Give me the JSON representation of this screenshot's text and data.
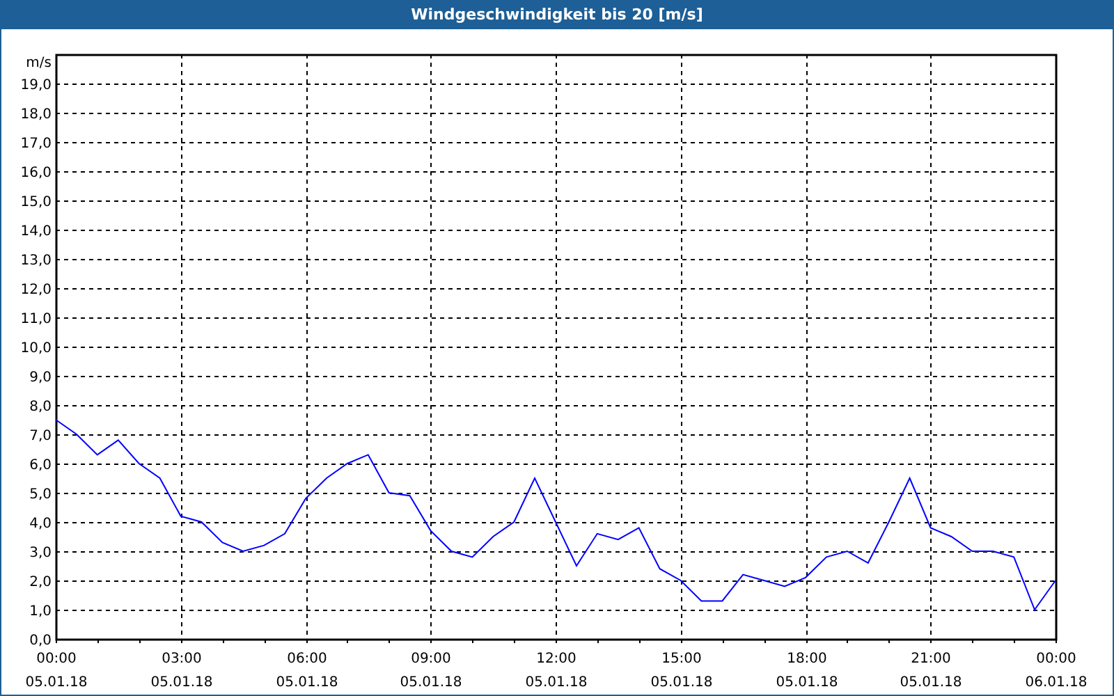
{
  "window": {
    "title": "Windgeschwindigkeit bis 20 [m/s]"
  },
  "chart": {
    "chart_data": {
      "type": "line",
      "ylabel": "m/s",
      "categories": [
        "00:00 05.01.18",
        null,
        null,
        null,
        null,
        null,
        "03:00 05.01.18",
        null,
        null,
        null,
        null,
        null,
        "06:00 05.01.18",
        null,
        null,
        null,
        null,
        null,
        "09:00 05.01.18",
        null,
        null,
        null,
        null,
        null,
        "12:00 05.01.18",
        null,
        null,
        null,
        null,
        null,
        "15:00 05.01.18",
        null,
        null,
        null,
        null,
        null,
        "18:00 05.01.18",
        null,
        null,
        null,
        null,
        null,
        "21:00 05.01.18",
        null,
        null,
        null,
        null,
        null,
        "00:00 06.01.18"
      ],
      "series": [
        {
          "color": "#0000ff",
          "values": [
            7.5,
            7.0,
            6.3,
            6.8,
            6.0,
            5.5,
            4.2,
            4.0,
            3.3,
            3.0,
            3.2,
            3.6,
            4.8,
            5.5,
            6.0,
            6.3,
            5.0,
            4.9,
            3.7,
            3.0,
            2.8,
            3.5,
            4.0,
            5.5,
            4.0,
            2.5,
            3.6,
            3.4,
            3.8,
            2.4,
            2.0,
            1.3,
            1.3,
            2.2,
            2.0,
            1.8,
            2.1,
            2.8,
            3.0,
            2.6,
            4.0,
            5.5,
            3.8,
            3.5,
            3.0,
            3.0,
            2.8,
            1.0,
            2.0
          ]
        }
      ],
      "ylim": [
        0,
        20
      ],
      "grid": true,
      "yticks": [
        {
          "value": 0,
          "label": "0,0"
        },
        {
          "value": 1,
          "label": "1,0"
        },
        {
          "value": 2,
          "label": "2,0"
        },
        {
          "value": 3,
          "label": "3,0"
        },
        {
          "value": 4,
          "label": "4,0"
        },
        {
          "value": 5,
          "label": "5,0"
        },
        {
          "value": 6,
          "label": "6,0"
        },
        {
          "value": 7,
          "label": "7,0"
        },
        {
          "value": 8,
          "label": "8,0"
        },
        {
          "value": 9,
          "label": "9,0"
        },
        {
          "value": 10,
          "label": "10,0"
        },
        {
          "value": 11,
          "label": "11,0"
        },
        {
          "value": 12,
          "label": "12,0"
        },
        {
          "value": 13,
          "label": "13,0"
        },
        {
          "value": 14,
          "label": "14,0"
        },
        {
          "value": 15,
          "label": "15,0"
        },
        {
          "value": 16,
          "label": "16,0"
        },
        {
          "value": 17,
          "label": "17,0"
        },
        {
          "value": 18,
          "label": "18,0"
        },
        {
          "value": 19,
          "label": "19,0"
        }
      ]
    }
  }
}
